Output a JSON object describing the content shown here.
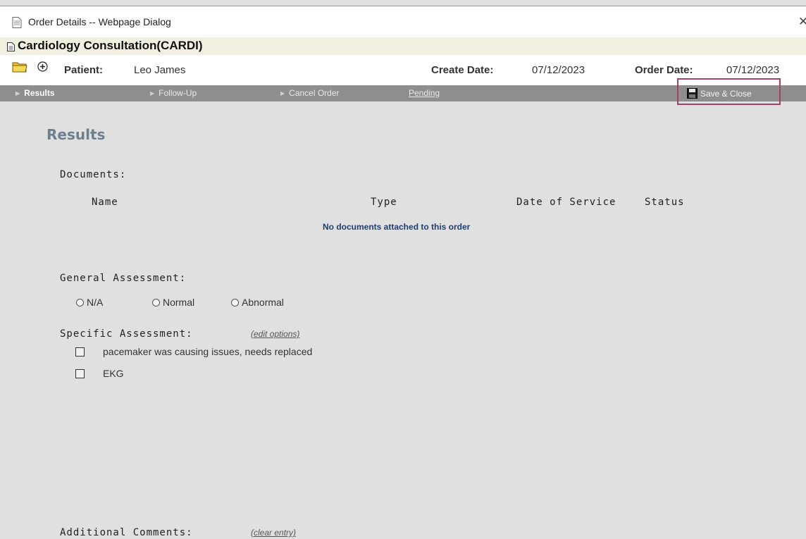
{
  "window": {
    "title": "Order Details -- Webpage Dialog",
    "close_symbol": "✕"
  },
  "order": {
    "title": "Cardiology Consultation(CARDI)"
  },
  "patient_bar": {
    "patient_label": "Patient:",
    "patient_name": "Leo James",
    "create_date_label": "Create Date:",
    "create_date": "07/12/2023",
    "order_date_label": "Order Date:",
    "order_date": "07/12/2023"
  },
  "toolbar": {
    "results": "Results",
    "follow_up": "Follow-Up",
    "cancel_order": "Cancel Order",
    "pending": "Pending",
    "save_close": "Save & Close"
  },
  "main": {
    "section_title": "Results",
    "documents_label": "Documents:",
    "columns": [
      "Name",
      "Type",
      "Date of Service",
      "Status"
    ],
    "no_documents": "No documents attached to this order",
    "general_assessment_label": "General Assessment:",
    "general_options": [
      "N/A",
      "Normal",
      "Abnormal"
    ],
    "specific_assessment_label": "Specific Assessment:",
    "edit_options": "(edit options)",
    "specific_options": [
      "pacemaker was causing issues, needs replaced",
      "EKG"
    ],
    "additional_comments_label": "Additional Comments:",
    "clear_entry": "(clear entry)"
  },
  "colors": {
    "toolbar_bg": "#8e8e8e",
    "highlight_border": "#a3406a",
    "section_title": "#6e7f8e",
    "no_docs_text": "#1f3f70"
  }
}
